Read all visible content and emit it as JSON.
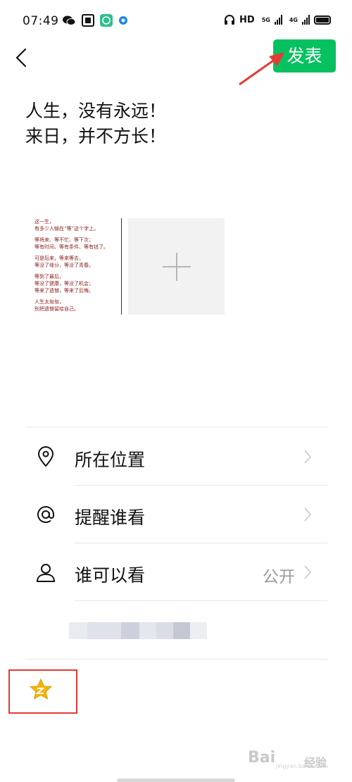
{
  "status_bar": {
    "time": "07:49",
    "left_icons": [
      "wechat-icon",
      "app-icon",
      "shield-app-icon",
      "circle-app-icon"
    ],
    "right_icons": [
      "headphones-icon",
      "hd-icon",
      "5g-signal-icon",
      "4g-signal-icon",
      "battery-icon"
    ],
    "hd_label": "HD",
    "signal_1_label": "5G",
    "signal_2_label": "4G"
  },
  "nav": {
    "publish_label": "发表",
    "back_icon": "chevron-left-icon"
  },
  "post": {
    "lines": [
      "人生，没有永远！",
      "来日，并不方长！"
    ]
  },
  "image_thumbnail": {
    "lines": [
      "这一生，",
      "有多少人输在“等”这个字上。",
      "",
      "等将来、等不忙、等下次；",
      "等有时间、等有条件、等有钱了。",
      "",
      "可是后来，等来等去，",
      "等没了缘分，等没了青春。",
      "",
      "等到了最后，",
      "等没了健康，等没了机会；",
      "等来了遗憾，等来了后悔。",
      "",
      "人生太匆匆，",
      "别把遗憾留给自己。"
    ]
  },
  "options": [
    {
      "icon": "location-pin-icon",
      "label": "所在位置",
      "value": ""
    },
    {
      "icon": "at-sign-icon",
      "label": "提醒谁看",
      "value": ""
    },
    {
      "icon": "person-icon",
      "label": "谁可以看",
      "value": "公开"
    }
  ],
  "emoji": {
    "icon": "star-emoji-icon"
  },
  "watermark": {
    "text": "Bai",
    "suffix": "经验",
    "sub": "jingyan.baidu.com"
  },
  "colors": {
    "accent": "#07c160",
    "highlight": "#e53935",
    "thumb_text": "#8a1c1c"
  }
}
